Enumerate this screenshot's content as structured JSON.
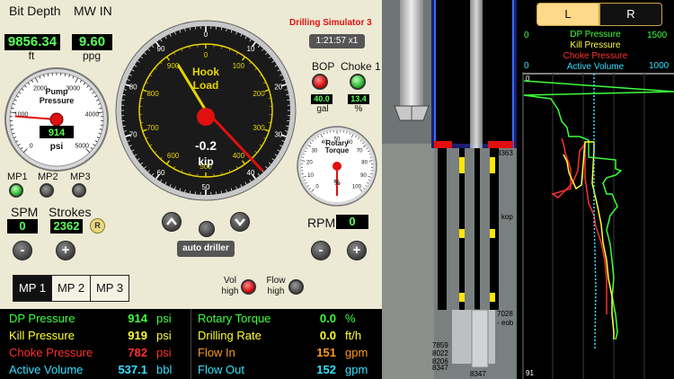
{
  "header": {
    "bit_depth_label": "Bit Depth",
    "bit_depth_value": "9856.34",
    "bit_depth_unit": "ft",
    "mw_in_label": "MW IN",
    "mw_in_value": "9.60",
    "mw_in_unit": "ppg",
    "title": "Drilling Simulator 3",
    "clock": "1:21:57 x1"
  },
  "pump_gauge": {
    "title_line1": "Pump",
    "title_line2": "Pressure",
    "value": "914",
    "unit": "psi",
    "ticks": [
      "0",
      "1000",
      "2000",
      "3000",
      "4000",
      "5000"
    ],
    "reading": 914,
    "max": 5000
  },
  "hook_gauge": {
    "title_line1": "Hook",
    "title_line2": "Load",
    "value": "-0.2",
    "unit": "kip",
    "outer_ticks": [
      "0",
      "10",
      "20",
      "30",
      "40",
      "50",
      "60",
      "70",
      "80",
      "90"
    ],
    "inner_ticks": [
      "0",
      "100",
      "200",
      "300",
      "400",
      "500",
      "600",
      "700",
      "800",
      "900"
    ]
  },
  "bop": {
    "bop_label": "BOP",
    "choke_label": "Choke 1",
    "bop_value": "40.0",
    "bop_unit": "gal",
    "choke_value": "13.4",
    "choke_unit": "%"
  },
  "rotary_gauge": {
    "title_line1": "Rotary",
    "title_line2": "Torque",
    "unit": "%",
    "ticks": [
      "0",
      "10",
      "20",
      "30",
      "40",
      "50",
      "60",
      "70",
      "80",
      "90",
      "100"
    ]
  },
  "pumps": {
    "mp1": "MP1",
    "mp2": "MP2",
    "mp3": "MP3",
    "spm_label": "SPM",
    "spm_value": "0",
    "strokes_label": "Strokes",
    "strokes_value": "2362",
    "reset_label": "R",
    "minus": "-",
    "plus": "+"
  },
  "rpm": {
    "label": "RPM",
    "value": "0",
    "minus": "-",
    "plus": "+"
  },
  "auto_driller": {
    "label": "auto driller"
  },
  "mp_select": [
    "MP 1",
    "MP 2",
    "MP 3"
  ],
  "alarms": {
    "vol_line1": "Vol",
    "vol_line2": "high",
    "flow_line1": "Flow",
    "flow_line2": "high"
  },
  "readouts": {
    "left": [
      {
        "label": "DP Pressure",
        "value": "914",
        "unit": "psi",
        "color": "#3cff3c"
      },
      {
        "label": "Kill Pressure",
        "value": "919",
        "unit": "psi",
        "color": "#ffff33"
      },
      {
        "label": "Choke Pressure",
        "value": "782",
        "unit": "psi",
        "color": "#ff3030"
      },
      {
        "label": "Active Volume",
        "value": "537.1",
        "unit": "bbl",
        "color": "#33e0ff"
      }
    ],
    "right": [
      {
        "label": "Rotary Torque",
        "value": "0.0",
        "unit": "%",
        "color": "#3cff3c"
      },
      {
        "label": "Drilling Rate",
        "value": "0.0",
        "unit": "ft/h",
        "color": "#ffff33"
      },
      {
        "label": "Flow In",
        "value": "151",
        "unit": "gpm",
        "color": "#ff9a1a"
      },
      {
        "label": "Flow Out",
        "value": "152",
        "unit": "gpm",
        "color": "#33e0ff"
      }
    ]
  },
  "well": {
    "depth_top": "3363",
    "kop": "- kop",
    "depth_eob": "7028",
    "eob": "- eob",
    "d1": "7859",
    "d2": "8022",
    "d3": "8206",
    "d4": "8347",
    "d5": "8347"
  },
  "log": {
    "tab_left": "L",
    "tab_right": "R",
    "scale_min": "0",
    "scale_max_pressure": "1500",
    "scale_max_volume": "1000",
    "dp_label": "DP Pressure",
    "kill_label": "Kill Pressure",
    "choke_label": "Choke Pressure",
    "vol_label": "Active Volume",
    "depth_top": "0",
    "depth_bottom": "91",
    "colors": {
      "dp": "#3cff3c",
      "kill": "#ffff33",
      "choke": "#ff3030",
      "vol": "#33e0ff"
    }
  }
}
